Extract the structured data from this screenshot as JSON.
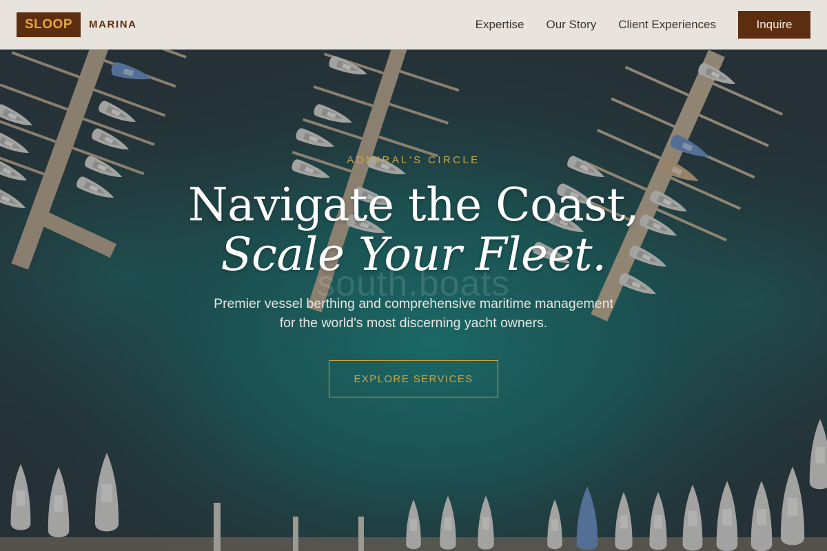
{
  "brand": {
    "name": "SLOOP",
    "sub": "MARINA"
  },
  "nav": {
    "links": [
      "Expertise",
      "Our Story",
      "Client Experiences"
    ],
    "cta_label": "Inquire"
  },
  "hero": {
    "eyebrow": "ADMIRAL'S CIRCLE",
    "headline_line1": "Navigate the Coast,",
    "headline_line2": "Scale Your Fleet.",
    "watermark": "south.boats",
    "subtext": "Premier vessel berthing and comprehensive maritime management for the world's most discerning yacht owners.",
    "cta_label": "EXPLORE SERVICES"
  },
  "colors": {
    "brand_brown": "#5c2d0e",
    "brand_gold": "#e0a93c",
    "accent_gold": "#c9a646",
    "nav_bg": "#e8e3dc",
    "water_dark": "#2c3a40",
    "water_teal": "#1f7f7a"
  },
  "icons": {
    "hero_background": "aerial-marina-photo"
  }
}
